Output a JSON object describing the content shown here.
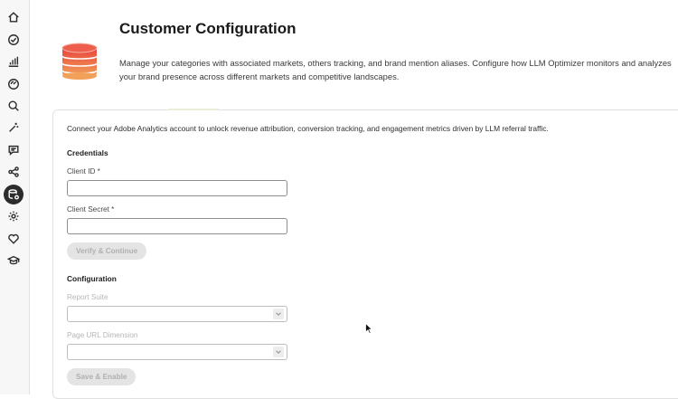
{
  "rail": {
    "items": [
      {
        "icon": "home-icon"
      },
      {
        "icon": "check-circle-icon"
      },
      {
        "icon": "bar-chart-icon"
      },
      {
        "icon": "gauge-icon"
      },
      {
        "icon": "search-icon"
      },
      {
        "icon": "magic-wand-icon"
      },
      {
        "icon": "comment-icon"
      },
      {
        "icon": "share-icon"
      },
      {
        "icon": "database-settings-icon",
        "active": true
      },
      {
        "icon": "gear-icon"
      },
      {
        "icon": "heart-icon"
      },
      {
        "icon": "learn-icon"
      }
    ]
  },
  "header": {
    "title": "Customer Configuration",
    "description": "Manage your categories with associated markets, others tracking, and brand mention aliases. Configure how LLM Optimizer monitors and analyzes your brand presence across different markets and competitive landscapes."
  },
  "card": {
    "intro": "Connect your Adobe Analytics account to unlock revenue attribution, conversion tracking, and engagement metrics driven by LLM referral traffic.",
    "credentials": {
      "title": "Credentials",
      "client_id_label": "Client ID *",
      "client_id_value": "",
      "client_secret_label": "Client Secret *",
      "client_secret_value": "",
      "verify_label": "Verify & Continue"
    },
    "configuration": {
      "title": "Configuration",
      "report_suite_label": "Report Suite",
      "report_suite_value": "",
      "page_url_label": "Page URL Dimension",
      "page_url_value": "",
      "save_label": "Save & Enable"
    }
  },
  "colors": {
    "rail_active": "#2c2c2c",
    "disabled_button_bg": "#e4e4e4",
    "disabled_button_text": "#b0b0b0",
    "logo_top": "#e8403a",
    "logo_bottom": "#f2a15a"
  }
}
